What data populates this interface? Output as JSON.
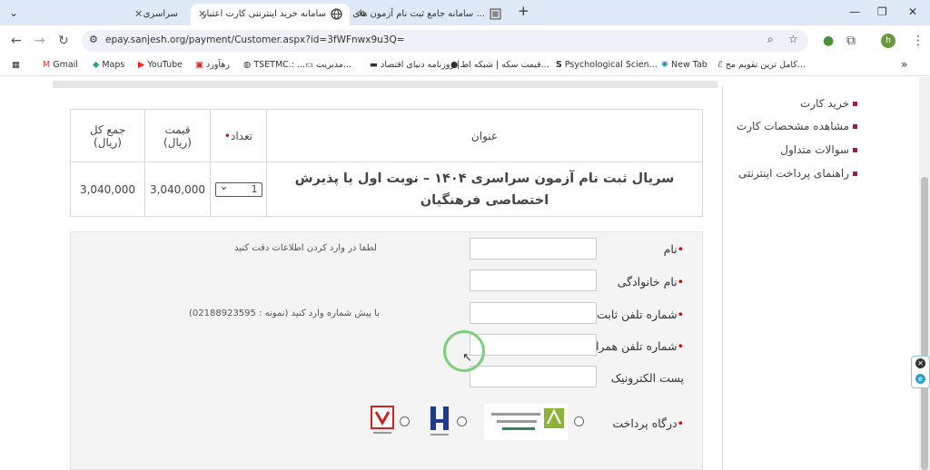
{
  "tabs": [
    {
      "label": "سراسری"
    },
    {
      "label": "سامانه خرید اینترنتی کارت اعتبار"
    },
    {
      "label": "سامانه جامع ثبت نام آزمون های ..."
    }
  ],
  "address": {
    "url": "epay.sanjesh.org/payment/Customer.aspx?id=3fWFnwx9u3Q="
  },
  "bookmarks": [
    "Gmail",
    "Maps",
    "YouTube",
    "رهآورد",
    "TSETMC.: ...",
    "مدیریت...",
    "روزنامه دنیای اقتصاد |...",
    "قیمت سکه | شبکه اط...",
    "Psychological Scien...",
    "New Tab",
    "کامل ترین تقویم مح..."
  ],
  "sidebar": {
    "items": [
      {
        "label": "خرید کارت"
      },
      {
        "label": "مشاهده مشخصات کارت"
      },
      {
        "label": "سوالات متداول"
      },
      {
        "label": "راهنمای پرداخت اینترنتی"
      }
    ]
  },
  "table": {
    "headers": {
      "title": "عنوان",
      "qty": "تعداد",
      "price": "قیمت",
      "price_unit": "(ریال)",
      "total": "جمع کل",
      "total_unit": "(ریال)"
    },
    "row": {
      "title": "سریال ثبت نام آزمون سراسری ۱۴۰۴ – نوبت اول یا پذیرش اختصاصی فرهنگیان",
      "qty": "1",
      "price": "3,040,000",
      "total": "3,040,000"
    }
  },
  "form": {
    "name_label": "نام",
    "name_hint": "لطفا در وارد کردن اطلاعات دقت کنید",
    "family_label": "نام خانوادگی",
    "phone_label": "شماره تلفن ثابت",
    "phone_hint": "با پیش شماره وارد کنید (نمونه : 02188923595)",
    "mobile_label": "شماره تلفن همراه",
    "email_label": "پست الکترونیک",
    "gateway_label": "درگاه پرداخت"
  },
  "colors": {
    "accent": "#b5133a",
    "tabbar": "#dee9f7"
  }
}
